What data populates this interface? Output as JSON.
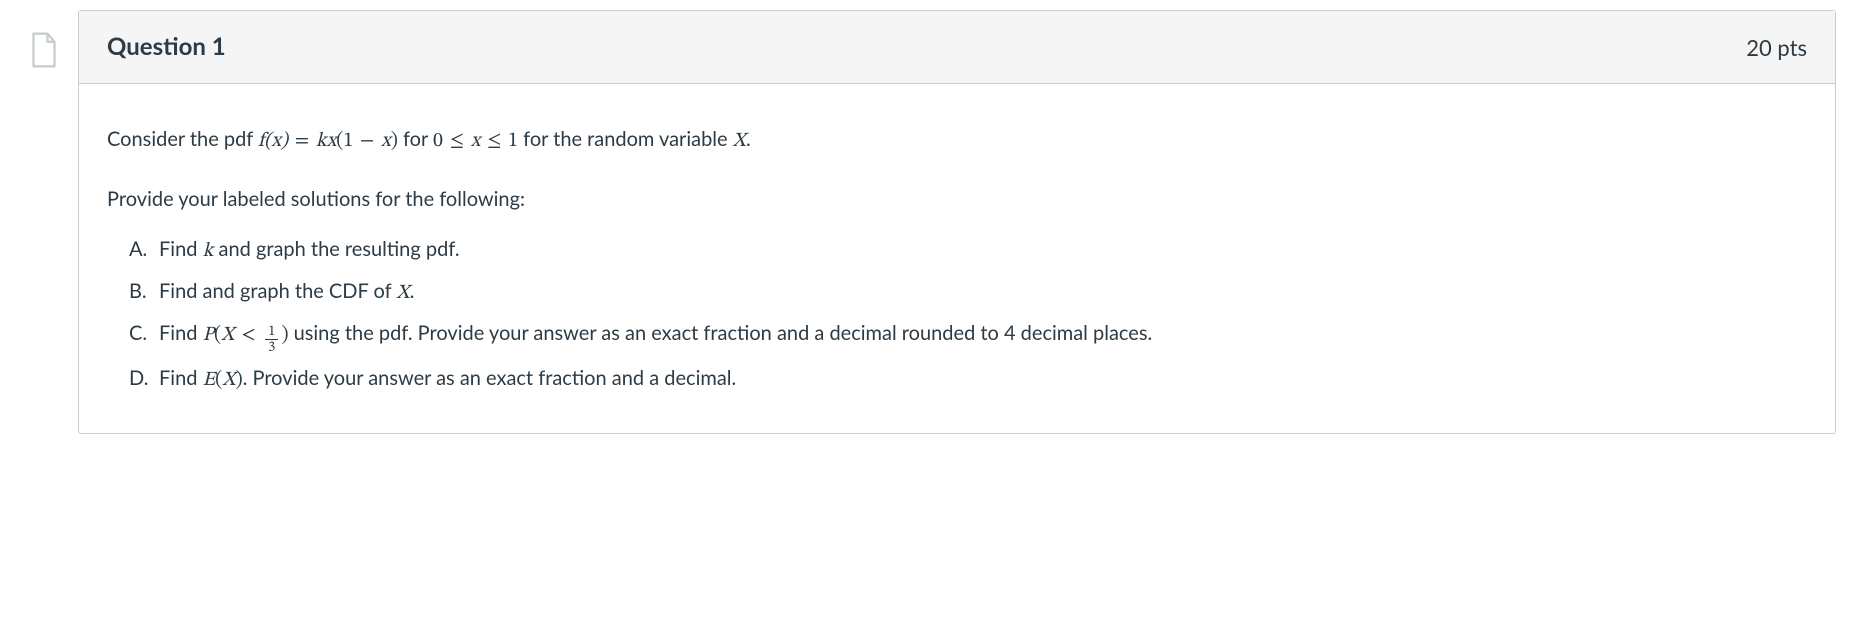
{
  "header": {
    "title": "Question 1",
    "points": "20 pts"
  },
  "body": {
    "intro_pre": "Consider the pdf ",
    "intro_mid": " for ",
    "intro_post": " for the random variable ",
    "intro_end": ".",
    "f_of_x": "f(x)",
    "eq": " = ",
    "kx_open": "kx",
    "lparen": "(",
    "one": "1",
    "minus": " − ",
    "x": "x",
    "rparen": ")",
    "zero": "0",
    "le": " ≤ ",
    "one2": "1",
    "X": "X",
    "instruction": "Provide your labeled solutions for the following:",
    "parts": {
      "a_marker": "A.",
      "a_pre": "Find ",
      "a_k": "k",
      "a_post": " and graph the resulting pdf.",
      "b_marker": "B.",
      "b_pre": "Find and graph the CDF of ",
      "b_X": "X",
      "b_post": ".",
      "c_marker": "C.",
      "c_pre": "Find ",
      "c_P": "P",
      "c_lparen": "(",
      "c_X": "X",
      "c_lt": " < ",
      "c_frac_num": "1",
      "c_frac_den": "3",
      "c_rparen": ")",
      "c_post": " using the pdf. Provide your answer as an exact fraction and a decimal rounded to 4 decimal places.",
      "d_marker": "D.",
      "d_pre": "Find ",
      "d_E": "E",
      "d_lparen": "(",
      "d_X": "X",
      "d_rparen": ")",
      "d_post": ". Provide your answer as an exact fraction and a decimal."
    }
  }
}
